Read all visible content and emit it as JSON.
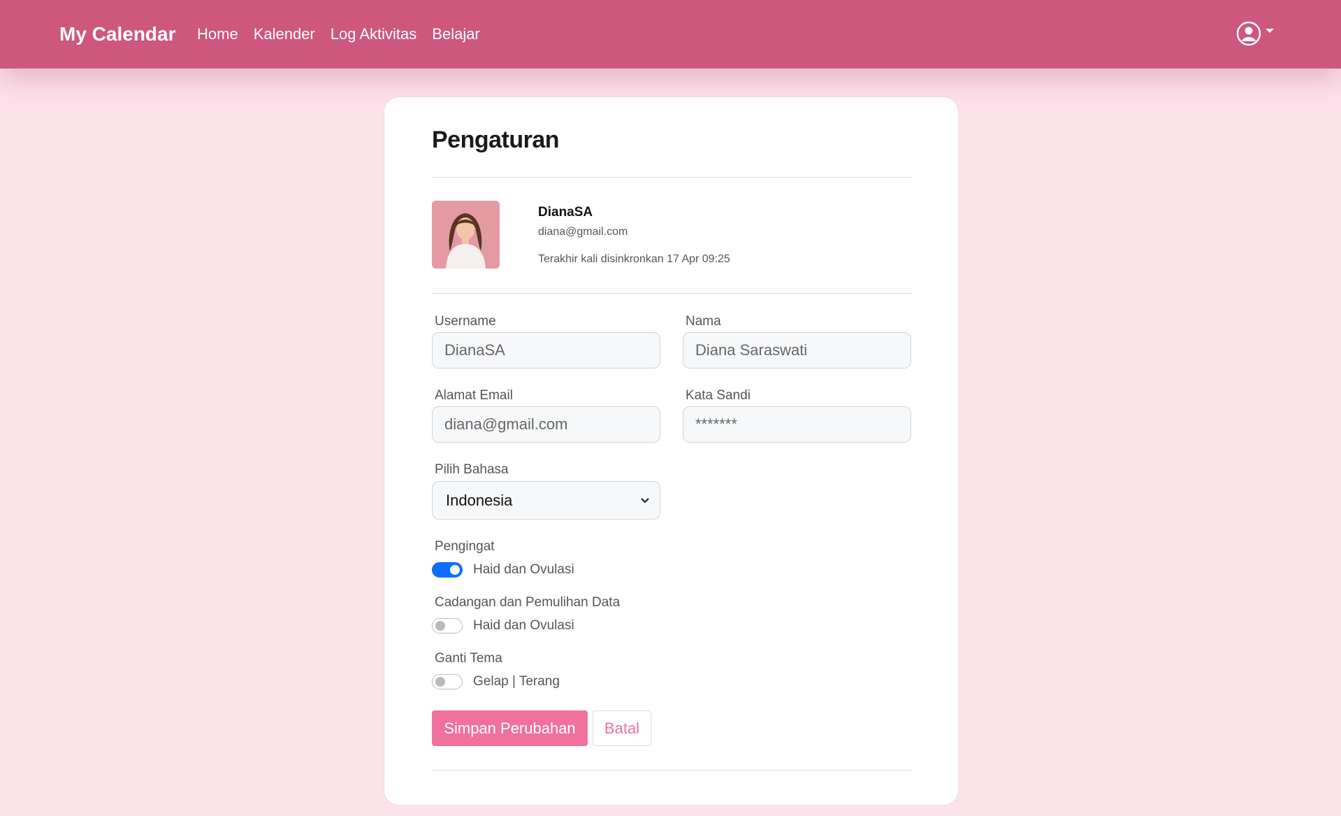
{
  "navbar": {
    "brand": "My Calendar",
    "links": [
      "Home",
      "Kalender",
      "Log Aktivitas",
      "Belajar"
    ],
    "user_icon": "user-circle-icon"
  },
  "settings": {
    "title": "Pengaturan",
    "profile": {
      "name": "DianaSA",
      "email": "diana@gmail.com",
      "last_sync": "Terakhir kali disinkronkan 17 Apr 09:25"
    },
    "fields": {
      "username": {
        "label": "Username",
        "value": "DianaSA"
      },
      "nama": {
        "label": "Nama",
        "value": "Diana Saraswati"
      },
      "email": {
        "label": "Alamat Email",
        "value": "diana@gmail.com"
      },
      "password": {
        "label": "Kata Sandi",
        "value": "*******"
      },
      "language": {
        "label": "Pilih Bahasa",
        "value": "Indonesia"
      }
    },
    "toggles": {
      "reminder": {
        "label": "Pengingat",
        "option": "Haid dan Ovulasi",
        "enabled": true
      },
      "backup": {
        "label": "Cadangan dan Pemulihan Data",
        "option": "Haid dan Ovulasi",
        "enabled": false
      },
      "theme": {
        "label": "Ganti Tema",
        "option": "Gelap | Terang",
        "enabled": false
      }
    },
    "buttons": {
      "save": "Simpan Perubahan",
      "cancel": "Batal"
    }
  },
  "colors": {
    "navbar": "#cd577d",
    "background": "#fde2ea",
    "accent": "#f0719d",
    "toggle_on": "#0d6efd"
  }
}
